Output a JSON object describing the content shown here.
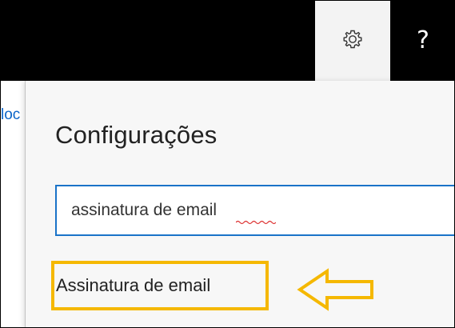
{
  "header": {
    "settings_icon": "gear-icon",
    "help_label": "?"
  },
  "background": {
    "partial_link_text": "loc"
  },
  "panel": {
    "title": "Configurações",
    "search": {
      "value": "assinatura de email",
      "placeholder": ""
    },
    "results": [
      {
        "label": "Assinatura de email"
      }
    ]
  },
  "annotation": {
    "arrow_icon": "left-arrow-icon",
    "highlight_color": "#f5b800"
  },
  "colors": {
    "topbar": "#000000",
    "accent": "#1a73c8",
    "panel_bg": "#f7f7f7",
    "link": "#0a64c8"
  }
}
